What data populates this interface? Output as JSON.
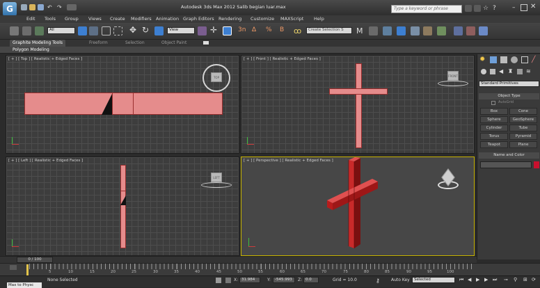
{
  "app": {
    "logo_text": "G",
    "title": "Autodesk 3ds Max 2012    Salib begian luar.max",
    "search_placeholder": "Type a keyword or phrase"
  },
  "menu": [
    "Edit",
    "Tools",
    "Group",
    "Views",
    "Create",
    "Modifiers",
    "Animation",
    "Graph Editors",
    "Rendering",
    "Customize",
    "MAXScript",
    "Help"
  ],
  "toolbar": {
    "selection_filter": "All",
    "reference_coord": "View",
    "named_selection": "Create Selection S"
  },
  "ribbon": {
    "tabs": [
      "Graphite Modeling Tools",
      "Freeform",
      "Selection",
      "Object Paint"
    ],
    "panel_label": "Polygon Modeling"
  },
  "viewports": {
    "top": "[ + ] [ Top ] [ Realistic + Edged Faces ]",
    "front": "[ + ] [ Front ] [ Realistic + Edged Faces ]",
    "left": "[ + ] [ Left ] [ Realistic + Edged Faces ]",
    "perspective": "[ + ] [ Perspective ] [ Realistic + Edged Faces ]",
    "cube_top": "TOP",
    "cube_front": "FRONT",
    "cube_left": "LEFT"
  },
  "command_panel": {
    "category": "Standard Primitives",
    "object_type_title": "Object Type",
    "autogrid": "AutoGrid",
    "buttons": [
      "Box",
      "Cone",
      "Sphere",
      "GeoSphere",
      "Cylinder",
      "Tube",
      "Torus",
      "Pyramid",
      "Teapot",
      "Plane"
    ],
    "name_color_title": "Name and Color",
    "color": "#c8102e"
  },
  "timeline": {
    "frame_counter": "0 / 100",
    "ticks": [
      "5",
      "10",
      "15",
      "20",
      "25",
      "30",
      "35",
      "40",
      "45",
      "50",
      "55",
      "60",
      "65",
      "70",
      "75",
      "80",
      "85",
      "90",
      "95",
      "100"
    ]
  },
  "status": {
    "selection": "None Selected",
    "prompt": "Max to Physc",
    "x_label": "X:",
    "x_value": "31.984",
    "y_label": "Y:",
    "y_value": "-545.993",
    "z_label": "Z:",
    "z_value": "0.0",
    "grid": "Grid = 10.0",
    "auto_key": "Auto Key",
    "key_mode": "Selected"
  },
  "colors": {
    "object_pink": "#e58c8c",
    "object_red": "#b71c1c",
    "active_viewport_border": "#c8b400"
  }
}
